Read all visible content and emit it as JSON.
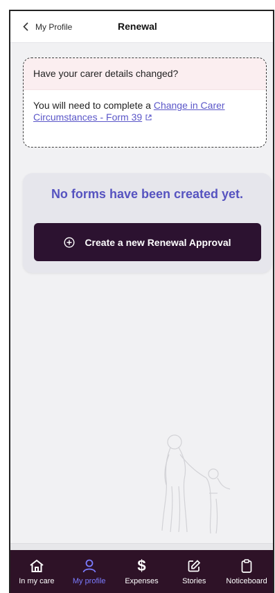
{
  "header": {
    "back_label": "My Profile",
    "title": "Renewal"
  },
  "info_card": {
    "question": "Have your carer details changed?",
    "body_prefix": "You will need to complete a ",
    "link_text": "Change in Carer Circumstances - Form 39"
  },
  "empty_state": {
    "title": "No forms have been created yet.",
    "button_label": "Create a new Renewal Approval"
  },
  "nav": {
    "items": [
      {
        "label": "In my care",
        "icon": "home-icon",
        "active": false
      },
      {
        "label": "My profile",
        "icon": "user-icon",
        "active": true
      },
      {
        "label": "Expenses",
        "icon": "dollar-icon",
        "active": false
      },
      {
        "label": "Stories",
        "icon": "edit-icon",
        "active": false
      },
      {
        "label": "Noticeboard",
        "icon": "clipboard-icon",
        "active": false
      }
    ]
  },
  "colors": {
    "accent": "#5653c0",
    "nav_bg": "#2e1227",
    "button_bg": "#2c1230",
    "nav_active": "#7b7cff",
    "info_header_bg": "#fbeef0"
  }
}
